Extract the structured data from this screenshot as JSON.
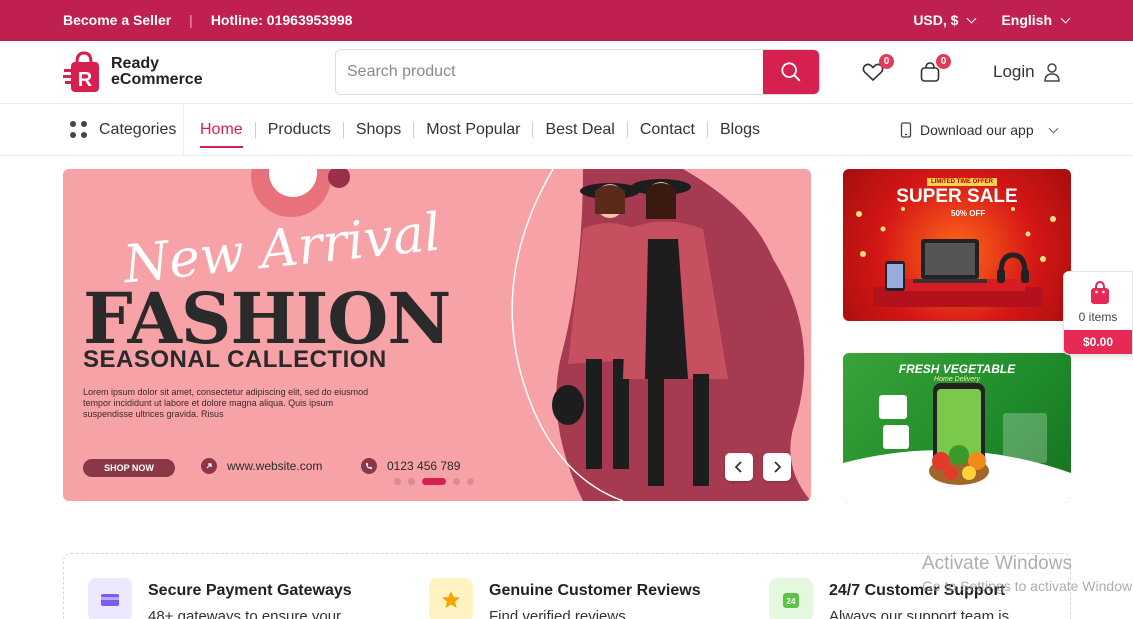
{
  "topbar": {
    "seller_link": "Become a Seller",
    "hotline": "Hotline: 01963953998",
    "currency": "USD, $",
    "language": "English",
    "bg_color": "#c0204f"
  },
  "header": {
    "logo_line1": "Ready",
    "logo_line2": "eCommerce",
    "search_placeholder": "Search product",
    "wishlist_count": "0",
    "cart_count": "0",
    "login_label": "Login",
    "accent_color": "#d6204f"
  },
  "nav": {
    "categories_label": "Categories",
    "items": [
      {
        "label": "Home",
        "active": true
      },
      {
        "label": "Products"
      },
      {
        "label": "Shops"
      },
      {
        "label": "Most Popular"
      },
      {
        "label": "Best Deal"
      },
      {
        "label": "Contact"
      },
      {
        "label": "Blogs"
      }
    ],
    "download_app": "Download our app"
  },
  "hero": {
    "script_text": "New Arrival",
    "headline": "FASHION",
    "subheadline": "SEASONAL CALLECTION",
    "body": "Lorem ipsum dolor sit amet, consectetur adipiscing elit, sed do eiusmod tempor incididunt ut labore et dolore magna aliqua. Quis ipsum suspendisse ultrices gravida. Risus",
    "shop_button": "SHOP NOW",
    "website": "www.website.com",
    "phone": "0123 456 789",
    "slide_count": 5,
    "active_slide": 3
  },
  "banners": {
    "sale_tag": "LIMITED TIME OFFER",
    "sale_title": "SUPER SALE",
    "sale_off": "50% OFF",
    "veg_title": "FRESH VEGETABLE",
    "veg_sub": "Home Delivery"
  },
  "cart_widget": {
    "items": "0 items",
    "total": "$0.00"
  },
  "features": [
    {
      "title": "Secure Payment Gateways",
      "desc": "48+ gateways to ensure your",
      "icon": "card-icon"
    },
    {
      "title": "Genuine Customer Reviews",
      "desc": "Find verified reviews",
      "icon": "star-icon"
    },
    {
      "title": "24/7 Customer Support",
      "desc": "Always our support team is",
      "icon": "support-24-icon"
    }
  ],
  "watermark": {
    "line1": "Activate Windows",
    "line2": "Go to Settings to activate Windows."
  }
}
